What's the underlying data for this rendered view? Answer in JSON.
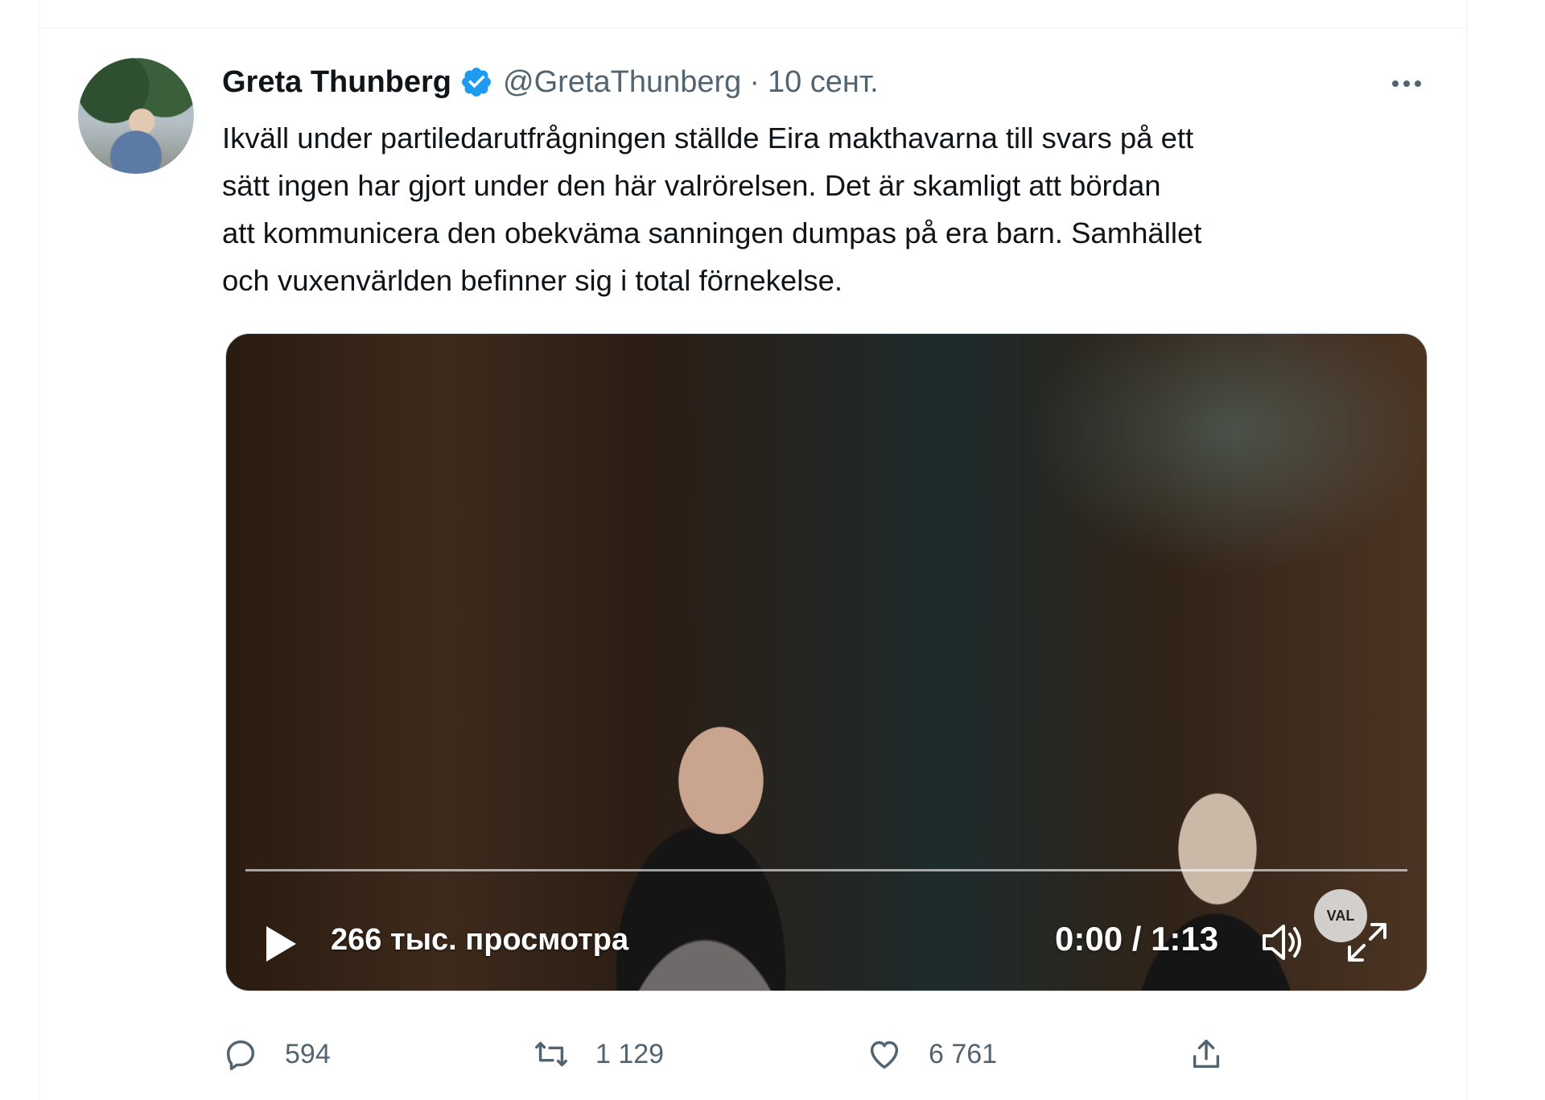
{
  "tweet": {
    "author_name": "Greta Thunberg",
    "handle": "@GretaThunberg",
    "separator": "·",
    "timestamp": "10 сент.",
    "text": "Ikväll under partiledarutfrågningen ställde Eira makthavarna till svars på ett\nsätt ingen har gjort under den här valrörelsen. Det är skamligt att bördan\natt kommunicera den obekväma sanningen dumpas på era barn. Samhället\noch vuxenvärlden befinner sig i total förnekelse."
  },
  "video": {
    "views": "266 тыс. просмотра",
    "time_current": "0:00",
    "time_separator": " / ",
    "time_total": "1:13",
    "logo_text": "VAL",
    "progress": 0
  },
  "actions": {
    "replies": "594",
    "retweets": "1 129",
    "likes": "6 761"
  },
  "colors": {
    "verified": "#1d9bf0",
    "secondary_text": "#536471",
    "primary_text": "#0f1419"
  },
  "icons": [
    "verified-badge-icon",
    "more-icon",
    "play-icon",
    "volume-icon",
    "fullscreen-icon",
    "reply-icon",
    "retweet-icon",
    "like-icon",
    "share-icon"
  ]
}
